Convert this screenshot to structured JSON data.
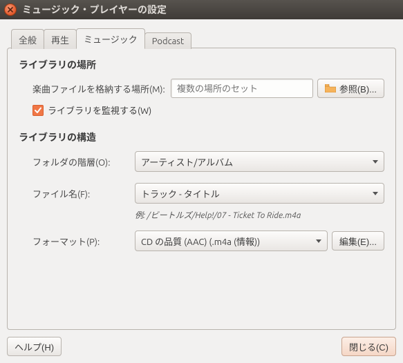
{
  "window": {
    "title": "ミュージック・プレイヤーの設定"
  },
  "tabs": {
    "items": [
      {
        "label": "全般",
        "active": false
      },
      {
        "label": "再生",
        "active": false
      },
      {
        "label": "ミュージック",
        "active": true
      },
      {
        "label": "Podcast",
        "active": false
      }
    ]
  },
  "section_location": {
    "title": "ライブラリの場所",
    "music_files_label": "楽曲ファイルを格納する場所(M):",
    "music_files_placeholder": "複数の場所のセット",
    "browse_label": "参照(B)...",
    "watch_label": "ライブラリを監視する(W)",
    "watch_checked": true
  },
  "section_structure": {
    "title": "ライブラリの構造",
    "folder_label": "フォルダの階層(O):",
    "folder_value": "アーティスト/アルバム",
    "file_label": "ファイル名(F):",
    "file_value": "トラック - タイトル",
    "example": "例: /ビートルズ/Help!/07 - Ticket To Ride.m4a",
    "format_label": "フォーマット(P):",
    "format_value": "CD の品質 (AAC) (.m4a (情報))",
    "edit_label": "編集(E)..."
  },
  "footer": {
    "help_label": "ヘルプ(H)",
    "close_label": "閉じる(C)"
  }
}
